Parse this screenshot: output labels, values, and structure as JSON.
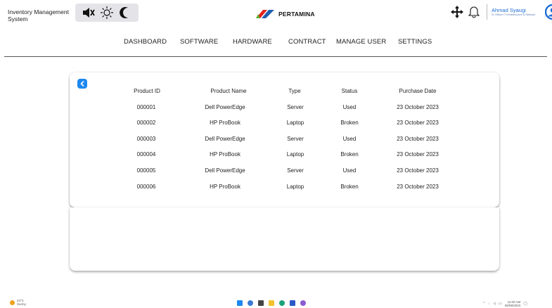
{
  "app": {
    "title": "Inventory Management System"
  },
  "mode_toggle": {
    "icons": [
      "mute-icon",
      "sun-icon",
      "moon-icon"
    ]
  },
  "logo": {
    "text": "PERTAMINA"
  },
  "user": {
    "name": "Ahmad Syaugi",
    "role": "Sr Officer IT Infrastructure & Network"
  },
  "nav": {
    "items": [
      {
        "label": "DASHBOARD"
      },
      {
        "label": "SOFTWARE"
      },
      {
        "label": "HARDWARE"
      },
      {
        "label": "CONTRACT"
      },
      {
        "label": "MANAGE USER"
      },
      {
        "label": "SETTINGS"
      }
    ]
  },
  "table": {
    "headers": [
      "Product ID",
      "Product Name",
      "Type",
      "Status",
      "Purchase Date"
    ],
    "rows": [
      [
        "000001",
        "Dell PowerEdge",
        "Server",
        "Used",
        "23 October 2023"
      ],
      [
        "000002",
        "HP ProBook",
        "Laptop",
        "Broken",
        "23 October 2023"
      ],
      [
        "000003",
        "Dell PowerEdge",
        "Server",
        "Used",
        "23 October 2023"
      ],
      [
        "000004",
        "HP ProBook",
        "Laptop",
        "Broken",
        "23 October 2023"
      ],
      [
        "000005",
        "Dell PowerEdge",
        "Server",
        "Used",
        "23 October 2023"
      ],
      [
        "000006",
        "HP ProBook",
        "Laptop",
        "Broken",
        "23 October 2023"
      ]
    ]
  },
  "taskbar": {
    "weather_temp": "24°C",
    "weather_desc": "Sunny",
    "time": "11:00 AM",
    "date": "09/09/2023"
  },
  "colors": {
    "accent": "#1e88f0",
    "logo_red": "#e2231a",
    "logo_green": "#5fb233",
    "logo_blue": "#1f5fb0"
  }
}
